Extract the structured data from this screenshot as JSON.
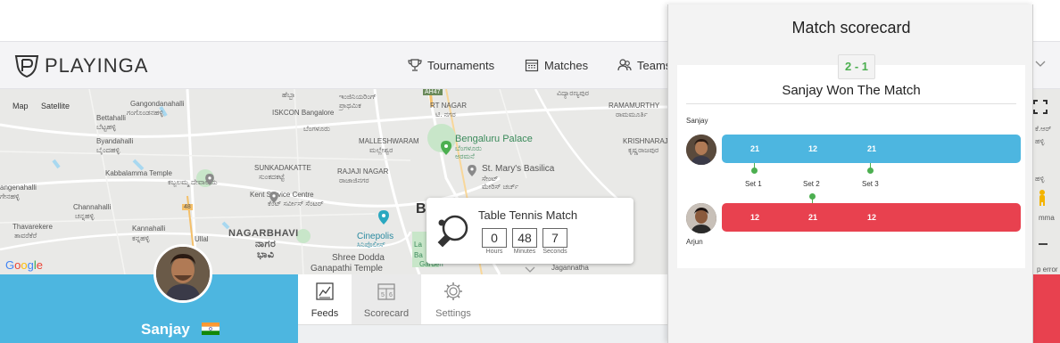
{
  "brand": {
    "name": "PLAYINGA"
  },
  "nav": {
    "tournaments": "Tournaments",
    "matches": "Matches",
    "teams": "Teams"
  },
  "map": {
    "map_btn": "Map",
    "satellite_btn": "Satellite",
    "google": "Google",
    "labels": {
      "bettahalli": "Bettahalli",
      "bettahalli_kn": "ಬೆಟ್ಟಹಳ್ಳಿ",
      "gangondanahalli": "Gangondanahalli",
      "gangondanahalli_kn": "ಗಂಗೊಂಡನಹಳ್ಳಿ",
      "byandahalli": "Byandahalli",
      "byandahalli_kn": "ಬೈಂದಹಳ್ಳಿ",
      "iskcon": "ISKCON Bangalore",
      "iskcon_kn": "ಬೆಂಗಳೂರು",
      "kabbalamma": "Kabbalamma Temple",
      "kabbalamma_kn": "ಕಬ್ಬಲಮ್ಮ ದೇವಾಲಯ",
      "angenahalli": "angenahalli",
      "angenahalli_kn": "ಗೇನಹಳ್ಳಿ",
      "chennahalli": "Channahalli",
      "chennahalli_kn": "ಚನ್ನಹಳ್ಳಿ",
      "thavarekere": "Thavarekere",
      "thavarekere_kn": "ತಾವರೆಕೆರೆ",
      "kannahalli": "Kannahalli",
      "kannahalli_kn": "ಕನ್ನಹಳ್ಳಿ",
      "ullal": "Ullal",
      "nagarbhavi": "NAGARBHAVI",
      "nagarbhavi_kn1": "ನಾಗರ",
      "nagarbhavi_kn2": "ಭಾವಿ",
      "kent": "Kent Service Centre",
      "kent_kn": "ಕೆಂಟ್ ಸರ್ವೀಸ್ ಸೆಂಟರ್",
      "sunkadakatte": "SUNKADAKATTE",
      "sunkadakatte_kn": "ಸುಂಕದಕಟ್ಟೆ",
      "rajaji": "RAJAJI NAGAR",
      "rajaji_kn": "ರಾಜಾಜಿನಗರ",
      "malleshwaram": "MALLESHWARAM",
      "malleshwaram_kn": "ಮಲ್ಲೇಶ್ವರ",
      "palace": "Bengaluru Palace",
      "palace_kn1": "ಬೆಂಗಳೂರು",
      "palace_kn2": "ಅರಮನೆ",
      "stmarys": "St. Mary's Basilica",
      "stmarys_kn1": "ಸೇಂಟ್",
      "stmarys_kn2": "ಮೇರಿಸ್ ಚರ್ಚ್",
      "rtnagar": "RT NAGAR",
      "rtnagar_kn": "ಟಿ. ನಗರ",
      "ramamurthy": "RAMAMURTHY",
      "ramamurthy_kn": "ರಾಮಮೂರ್ತಿ",
      "krishnarajapuram": "KRISHNARAJAPURA",
      "krishnarajapuram_kn": "ಕೃಷ್ಣರಾಜಪುರ",
      "cinepolis": "Cinepolis",
      "cinepolis_kn": "ಸಿನಿಪೊಲೀಸ್",
      "shreedodda": "Shree Dodda",
      "ganapathi": "Ganapathi Temple",
      "jagannatha": "Jagannatha",
      "ah47": "AH47",
      "road48": "48",
      "b": "B",
      "lal": "La",
      "ba": "Ba",
      "gar": "Garden",
      "hebbal_kn": "ಹೆಬ್ಬಾ",
      "inner_kn": "ಇಂಜಿನಿಯರಿಂಗ್",
      "inner_kn2": "ಪ್ರಾಥಮಿಕ",
      "vidya_kn": "ವಿದ್ಯಾರಣ್ಯಪುರ",
      "right_kn": "ಹಳ್ಳಿ",
      "right_kn2": "ಹಳ್ಳಿ",
      "mma": "mma",
      "herror": "p error",
      "pyqp": "ಕೆ.ಆರ್"
    }
  },
  "popup": {
    "title": "Table Tennis Match",
    "hours": "0",
    "minutes": "48",
    "seconds": "7",
    "hours_lbl": "Hours",
    "minutes_lbl": "Minutes",
    "seconds_lbl": "Seconds"
  },
  "profile": {
    "name": "Sanjay"
  },
  "tabs": {
    "feeds": "Feeds",
    "scorecard": "Scorecard",
    "settings": "Settings"
  },
  "scorecard": {
    "title": "Match scorecard",
    "score": "2 - 1",
    "result": "Sanjay Won The Match",
    "player1": "Sanjay",
    "player2": "Arjun",
    "p1_scores": [
      "21",
      "12",
      "21"
    ],
    "p2_scores": [
      "12",
      "21",
      "12"
    ],
    "sets": [
      "Set 1",
      "Set 2",
      "Set 3"
    ]
  },
  "colors": {
    "blue": "#4db6e0",
    "red": "#e8414f",
    "green": "#4caf50"
  }
}
